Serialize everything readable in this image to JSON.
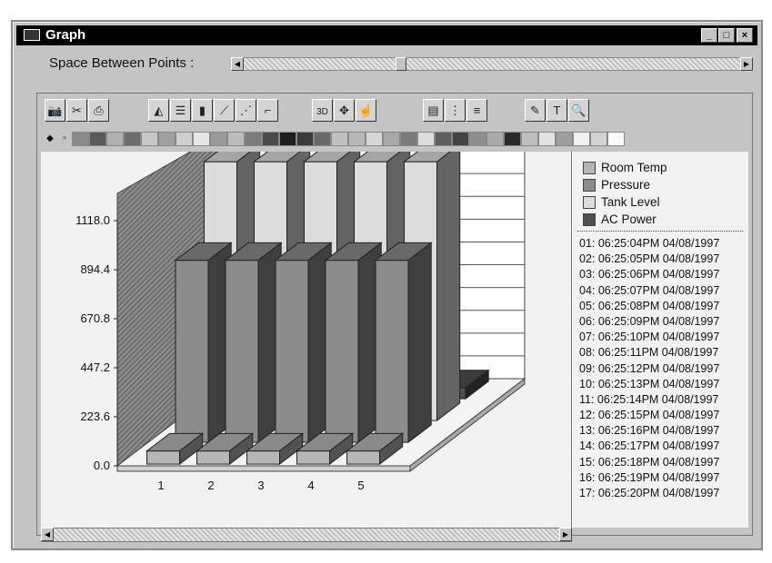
{
  "window": {
    "title": "Graph"
  },
  "window_controls": {
    "minimize": "_",
    "maximize": "□",
    "close": "×"
  },
  "slider": {
    "label": "Space Between Points :",
    "value_fraction": 0.31,
    "left_arrow": "◀",
    "right_arrow": "▶"
  },
  "toolbar": {
    "groups": [
      [
        {
          "name": "camera-icon",
          "glyph": "📷"
        },
        {
          "name": "scissors-icon",
          "glyph": "✂"
        },
        {
          "name": "printer-icon",
          "glyph": "⎙"
        }
      ],
      [
        {
          "name": "area-chart-icon",
          "glyph": "◭"
        },
        {
          "name": "horizontal-bar-icon",
          "glyph": "☰"
        },
        {
          "name": "bar-chart-icon",
          "glyph": "▮"
        },
        {
          "name": "line-chart-icon",
          "glyph": "⟋"
        },
        {
          "name": "scatter-chart-icon",
          "glyph": "⋰"
        },
        {
          "name": "step-chart-icon",
          "glyph": "⌐"
        }
      ],
      [
        {
          "name": "3d-toggle-icon",
          "glyph": "3D"
        },
        {
          "name": "rotate-icon",
          "glyph": "✥"
        },
        {
          "name": "pointer-icon",
          "glyph": "☝"
        }
      ],
      [
        {
          "name": "document-icon",
          "glyph": "▤"
        },
        {
          "name": "vertical-grid-icon",
          "glyph": "⋮"
        },
        {
          "name": "horizontal-grid-icon",
          "glyph": "≡"
        }
      ],
      [
        {
          "name": "palette-tool-icon",
          "glyph": "✎"
        },
        {
          "name": "font-icon",
          "glyph": "T"
        },
        {
          "name": "zoom-icon",
          "glyph": "🔍"
        }
      ]
    ]
  },
  "palette": {
    "colors": [
      "#8a8a8a",
      "#5a5a5a",
      "#b0b0b0",
      "#6e6e6e",
      "#c8c8c8",
      "#a0a0a0",
      "#d0d0d0",
      "#e6e6e6",
      "#9a9a9a",
      "#bcbcbc",
      "#7c7c7c",
      "#4a4a4a",
      "#1e1e1e",
      "#3a3a3a",
      "#6a6a6a",
      "#c0c0c0",
      "#b8b8b8",
      "#d6d6d6",
      "#a8a8a8",
      "#7a7a7a",
      "#dcdcdc",
      "#5e5e5e",
      "#444444",
      "#8e8e8e",
      "#aaaaaa",
      "#2a2a2a",
      "#bebebe",
      "#e2e2e2",
      "#9e9e9e",
      "#f0f0f0",
      "#d2d2d2",
      "#fafafa"
    ]
  },
  "legend": [
    {
      "label": "Room Temp",
      "color": "#b6b6b6"
    },
    {
      "label": "Pressure",
      "color": "#8c8c8c"
    },
    {
      "label": "Tank Level",
      "color": "#dcdcdc"
    },
    {
      "label": "AC Power",
      "color": "#4e4e4e"
    }
  ],
  "timestamps": [
    "01: 06:25:04PM 04/08/1997",
    "02: 06:25:05PM 04/08/1997",
    "03: 06:25:06PM 04/08/1997",
    "04: 06:25:07PM 04/08/1997",
    "05: 06:25:08PM 04/08/1997",
    "06: 06:25:09PM 04/08/1997",
    "07: 06:25:10PM 04/08/1997",
    "08: 06:25:11PM 04/08/1997",
    "09: 06:25:12PM 04/08/1997",
    "10: 06:25:13PM 04/08/1997",
    "11: 06:25:14PM 04/08/1997",
    "12: 06:25:15PM 04/08/1997",
    "13: 06:25:16PM 04/08/1997",
    "14: 06:25:17PM 04/08/1997",
    "15: 06:25:18PM 04/08/1997",
    "16: 06:25:19PM 04/08/1997",
    "17: 06:25:20PM 04/08/1997"
  ],
  "scrollbar": {
    "left_arrow": "◀",
    "right_arrow": "▶"
  },
  "chart_data": {
    "type": "bar",
    "categories": [
      "1",
      "2",
      "3",
      "4",
      "5"
    ],
    "series": [
      {
        "name": "Room Temp",
        "values": [
          60,
          60,
          60,
          60,
          60
        ]
      },
      {
        "name": "Pressure",
        "values": [
          830,
          830,
          830,
          830,
          830
        ]
      },
      {
        "name": "Tank Level",
        "values": [
          1180,
          1180,
          1180,
          1180,
          1180
        ]
      },
      {
        "name": "AC Power",
        "values": [
          50,
          50,
          50,
          50,
          50
        ]
      }
    ],
    "yticks": [
      "0.0",
      "223.6",
      "447.2",
      "670.8",
      "894.4",
      "1118.0"
    ],
    "ylim": [
      0,
      1118
    ],
    "grid": true,
    "legend_position": "right"
  }
}
